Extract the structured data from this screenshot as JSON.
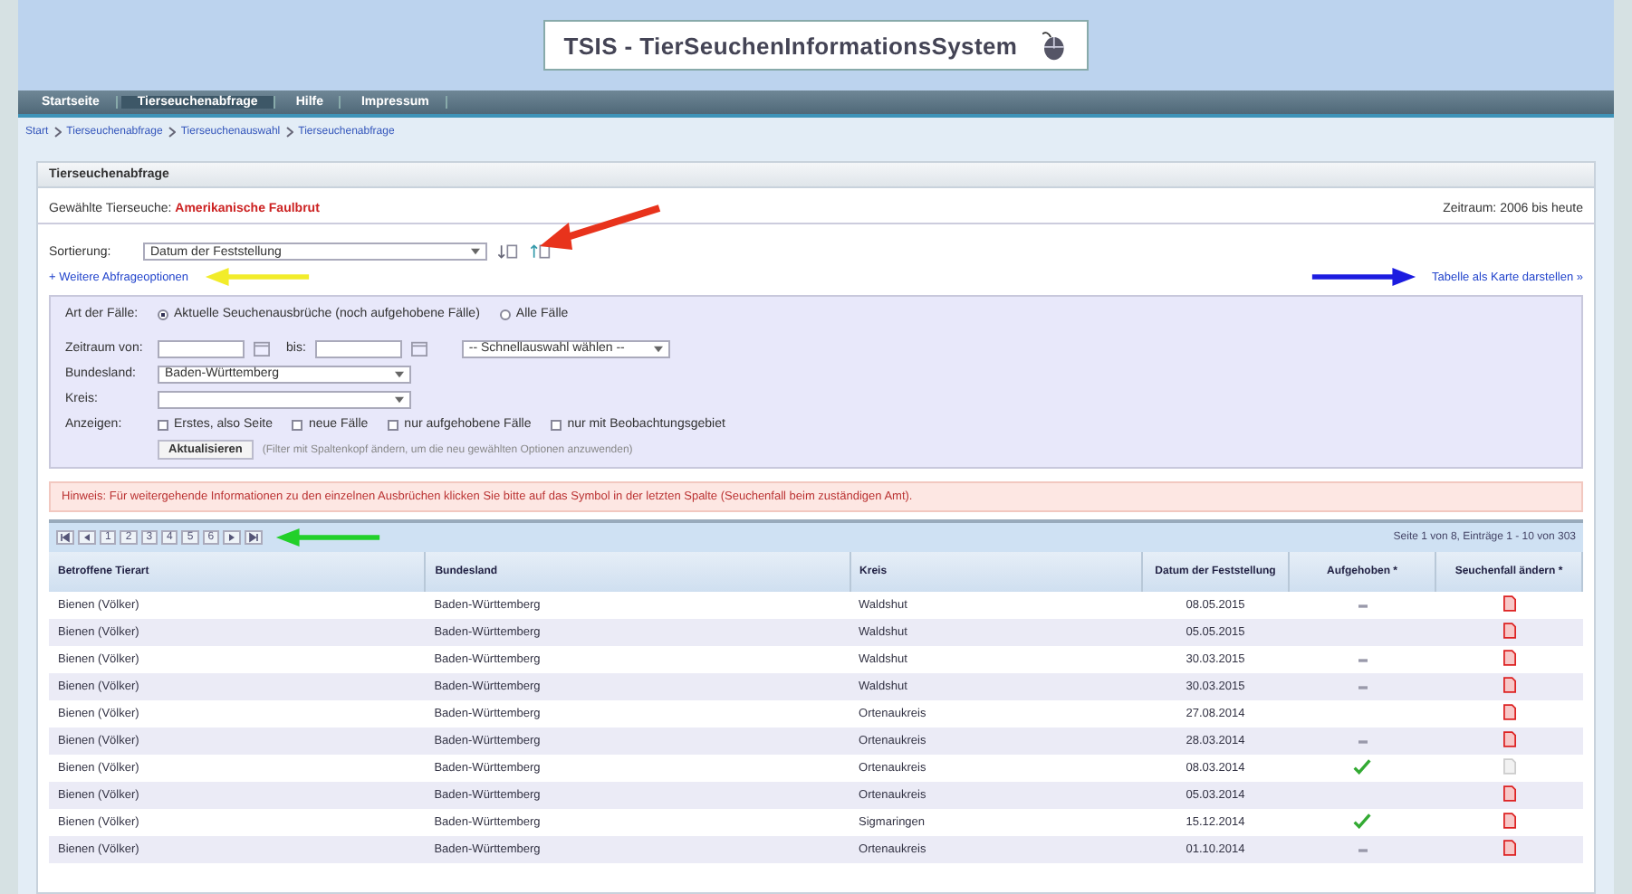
{
  "header": {
    "title": "TSIS - TierSeuchenInformationsSystem"
  },
  "nav": [
    {
      "label": "Startseite",
      "selected": false
    },
    {
      "label": "Tierseuchenabfrage",
      "selected": true
    },
    {
      "label": "Hilfe",
      "selected": false
    },
    {
      "label": "Impressum",
      "selected": false
    }
  ],
  "breadcrumb": [
    "Start",
    "Tierseuchenabfrage",
    "Tierseuchenauswahl",
    "Tierseuchenabfrage"
  ],
  "panel": {
    "title": "Tierseuchenabfrage",
    "chosen_label": "Gewählte Tierseuche:",
    "chosen_value": "Amerikanische Faulbrut",
    "period": "Zeitraum: 2006 bis heute"
  },
  "sorting": {
    "label": "Sortierung:",
    "value": "Datum der Feststellung"
  },
  "options_link": {
    "label": "+ Weitere Abfrageoptionen"
  },
  "map_link": {
    "label": "Tabelle als Karte darstellen »"
  },
  "filters": {
    "case_label": "Art der Fälle:",
    "case_options": [
      {
        "label": "Aktuelle Seuchenausbrüche (noch aufgehobene Fälle)",
        "selected": true
      },
      {
        "label": "Alle Fälle",
        "selected": false
      }
    ],
    "from_label": "Zeitraum von:",
    "to_label": "bis:",
    "quick_select": "-- Schnellauswahl wählen --",
    "state_label": "Bundesland:",
    "state_value": "Baden-Württemberg",
    "district_label": "Kreis:",
    "show_label": "Anzeigen:",
    "show_options": [
      {
        "label": "Erstes, also Seite",
        "checked": false
      },
      {
        "label": "neue Fälle",
        "checked": false
      },
      {
        "label": "nur aufgehobene Fälle",
        "checked": false
      },
      {
        "label": "nur mit Beobachtungsgebiet",
        "checked": false
      }
    ],
    "refresh": "Aktualisieren",
    "refresh_hint": "(Filter mit Spaltenkopf ändern, um die neu gewählten Optionen anzuwenden)"
  },
  "notice": "Hinweis: Für weitergehende Informationen zu den einzelnen Ausbrüchen klicken Sie bitte auf das Symbol in der letzten Spalte (Seuchenfall beim zuständigen Amt).",
  "pager": {
    "pages": [
      "1",
      "2",
      "3",
      "4",
      "5",
      "6"
    ],
    "summary": "Seite 1 von 8, Einträge 1 - 10 von 303"
  },
  "table": {
    "columns": [
      "Betroffene Tierart",
      "Bundesland",
      "Kreis",
      "Datum der Feststellung",
      "Aufgehoben *",
      "Seuchenfall ändern *"
    ],
    "rows": [
      {
        "species": "Bienen (Völker)",
        "state": "Baden-Württemberg",
        "district": "Waldshut",
        "date": "08.05.2015",
        "lifted": false,
        "dash": true,
        "report": true
      },
      {
        "species": "Bienen (Völker)",
        "state": "Baden-Württemberg",
        "district": "Waldshut",
        "date": "05.05.2015",
        "lifted": false,
        "dash": false,
        "report": true
      },
      {
        "species": "Bienen (Völker)",
        "state": "Baden-Württemberg",
        "district": "Waldshut",
        "date": "30.03.2015",
        "lifted": false,
        "dash": true,
        "report": true
      },
      {
        "species": "Bienen (Völker)",
        "state": "Baden-Württemberg",
        "district": "Waldshut",
        "date": "30.03.2015",
        "lifted": false,
        "dash": true,
        "report": true
      },
      {
        "species": "Bienen (Völker)",
        "state": "Baden-Württemberg",
        "district": "Ortenaukreis",
        "date": "27.08.2014",
        "lifted": false,
        "dash": false,
        "report": true
      },
      {
        "species": "Bienen (Völker)",
        "state": "Baden-Württemberg",
        "district": "Ortenaukreis",
        "date": "28.03.2014",
        "lifted": false,
        "dash": true,
        "report": true
      },
      {
        "species": "Bienen (Völker)",
        "state": "Baden-Württemberg",
        "district": "Ortenaukreis",
        "date": "08.03.2014",
        "lifted": true,
        "report": false
      },
      {
        "species": "Bienen (Völker)",
        "state": "Baden-Württemberg",
        "district": "Ortenaukreis",
        "date": "05.03.2014",
        "lifted": false,
        "dash": false,
        "report": true
      },
      {
        "species": "Bienen (Völker)",
        "state": "Baden-Württemberg",
        "district": "Sigmaringen",
        "date": "15.12.2014",
        "lifted": true,
        "report": true
      },
      {
        "species": "Bienen (Völker)",
        "state": "Baden-Württemberg",
        "district": "Ortenaukreis",
        "date": "01.10.2014",
        "lifted": false,
        "dash": true,
        "report": true
      }
    ]
  }
}
